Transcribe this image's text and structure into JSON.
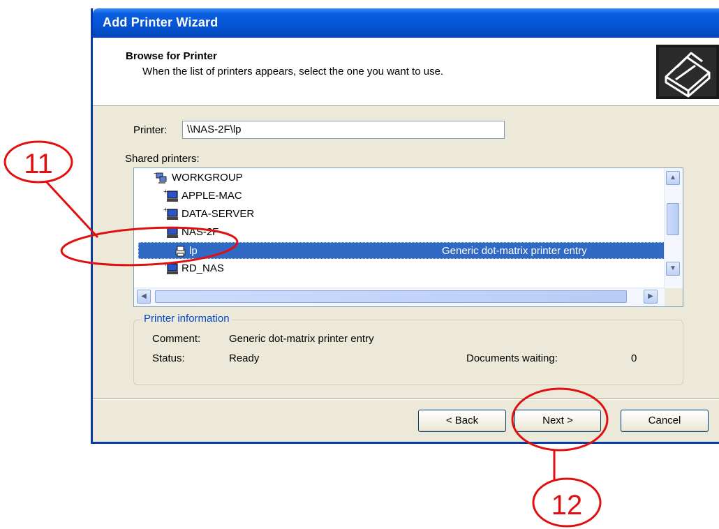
{
  "window": {
    "title": "Add Printer Wizard"
  },
  "header": {
    "title": "Browse for Printer",
    "subtitle": "When the list of printers appears, select the one you want to use.",
    "icon": "printer-wizard-icon"
  },
  "printer_field": {
    "label": "Printer:",
    "value": "\\\\NAS-2F\\lp"
  },
  "shared_printers": {
    "label": "Shared printers:",
    "items": [
      {
        "name": "WORKGROUP",
        "icon": "workgroup-icon",
        "expander": "−",
        "comment": ""
      },
      {
        "name": "APPLE-MAC",
        "icon": "computer-icon",
        "expander": "+",
        "comment": ""
      },
      {
        "name": "DATA-SERVER",
        "icon": "computer-icon",
        "expander": "+",
        "comment": ""
      },
      {
        "name": "NAS-2F",
        "icon": "computer-icon",
        "expander": "−",
        "comment": ""
      },
      {
        "name": "lp",
        "icon": "printer-icon",
        "expander": "",
        "comment": "Generic dot-matrix printer entry",
        "selected": true
      },
      {
        "name": "RD_NAS",
        "icon": "computer-icon",
        "expander": "+",
        "comment": ""
      }
    ]
  },
  "printer_info": {
    "legend": "Printer information",
    "comment_label": "Comment:",
    "comment_value": "Generic dot-matrix printer entry",
    "status_label": "Status:",
    "status_value": "Ready",
    "docs_label": "Documents waiting:",
    "docs_value": "0"
  },
  "buttons": {
    "back": "< Back",
    "next": "Next >",
    "cancel": "Cancel"
  },
  "annotations": {
    "step_a": "11",
    "step_b": "12",
    "color": "#e01010"
  },
  "colors": {
    "titlebar": "#0553d4",
    "selection": "#316ac5",
    "dialog_face": "#ece9d8",
    "group_legend": "#0046d5"
  }
}
